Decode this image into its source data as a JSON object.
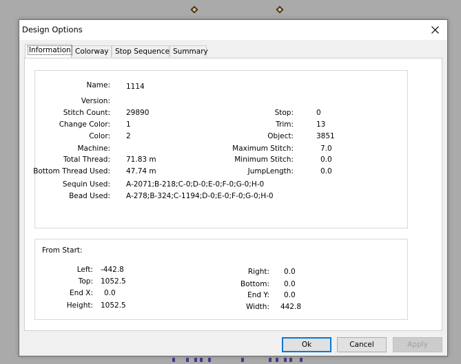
{
  "dialog": {
    "title": "Design Options",
    "close_icon": "close-icon"
  },
  "tabs": [
    {
      "label": "Information",
      "active": true
    },
    {
      "label": "Colorway",
      "active": false
    },
    {
      "label": "Stop Sequence",
      "active": false
    },
    {
      "label": "Summary",
      "active": false
    }
  ],
  "info": {
    "name_label": "Name:",
    "name_value": "1114",
    "version_label": "Version:",
    "version_value": "",
    "stitch_count_label": "Stitch Count:",
    "stitch_count_value": "29890",
    "change_color_label": "Change Color:",
    "change_color_value": "1",
    "color_label": "Color:",
    "color_value": "2",
    "machine_label": "Machine:",
    "machine_value": "",
    "total_thread_label": "Total Thread:",
    "total_thread_value": "71.83 m",
    "bottom_thread_label": "Bottom Thread Used:",
    "bottom_thread_value": "47.74 m",
    "sequin_label": "Sequin Used:",
    "sequin_value": "A-2071;B-218;C-0;D-0;E-0;F-0;G-0;H-0",
    "bead_label": "Bead Used:",
    "bead_value": "A-278;B-324;C-1194;D-0;E-0;F-0;G-0;H-0",
    "stop_label": "Stop:",
    "stop_value": "0",
    "trim_label": "Trim:",
    "trim_value": "13",
    "object_label": "Object:",
    "object_value": "3851",
    "max_stitch_label": "Maximum Stitch:",
    "max_stitch_value": "7.0",
    "min_stitch_label": "Minimum Stitch:",
    "min_stitch_value": "0.0",
    "jump_length_label": "JumpLength:",
    "jump_length_value": "0.0"
  },
  "from_start": {
    "heading": "From Start:",
    "left_label": "Left:",
    "left_value": "-442.8",
    "top_label": "Top:",
    "top_value": "1052.5",
    "end_x_label": "End X:",
    "end_x_value": "0.0",
    "height_label": "Height:",
    "height_value": "1052.5",
    "right_label": "Right:",
    "right_value": "0.0",
    "bottom_label": "Bottom:",
    "bottom_value": "0.0",
    "end_y_label": "End Y:",
    "end_y_value": "0.0",
    "width_label": "Width:",
    "width_value": "442.8"
  },
  "buttons": {
    "ok": "Ok",
    "cancel": "Cancel",
    "apply": "Apply",
    "apply_enabled": false
  },
  "colors": {
    "background": "#aaaaaa",
    "dialog": "#f0f0f0",
    "default_button_border": "#0078d7",
    "design_mark": "#4a3520",
    "sequin_mark": "#4a3a88"
  }
}
